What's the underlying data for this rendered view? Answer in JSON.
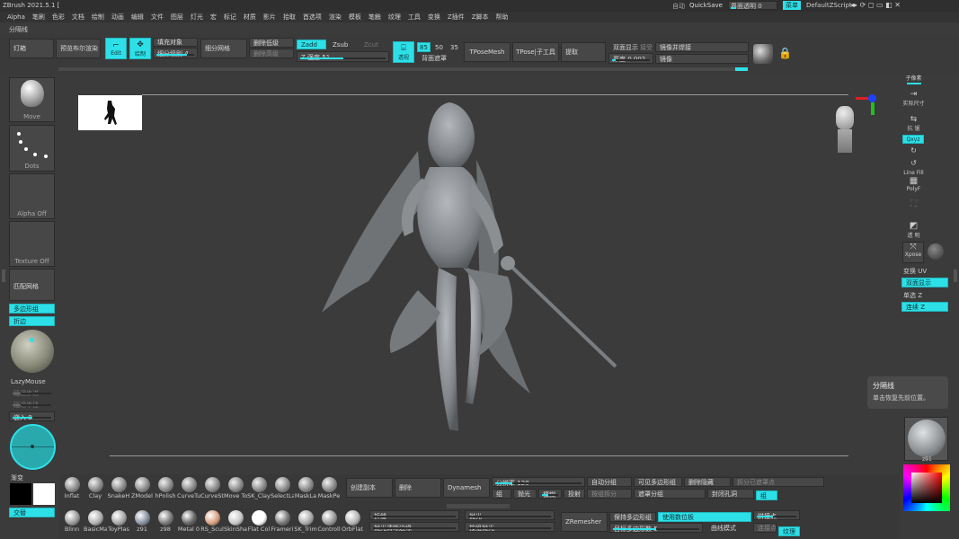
{
  "window": {
    "title": "ZBrush 2021.5.1 ["
  },
  "menu": [
    "Alpha",
    "笔刷",
    "色彩",
    "文档",
    "绘制",
    "动画",
    "编辑",
    "文件",
    "图层",
    "灯光",
    "宏",
    "标记",
    "材质",
    "影片",
    "拾取",
    "首选项",
    "渲染",
    "模板",
    "笔触",
    "纹理",
    "工具",
    "变换",
    "Z插件",
    "Z脚本",
    "帮助"
  ],
  "topright": {
    "auto": "自动",
    "quicksave": "QuickSave",
    "transparency_label": "界面透明 0",
    "menu_btn": "菜单",
    "script": "DefaultZScript"
  },
  "tray_label": "分隔线",
  "top_toolbar": {
    "light_box": "灯箱",
    "preview_boolean": "预览布尔渲染",
    "edit": "Edit",
    "draw": "绘制",
    "fill_object": "填充对象",
    "subdiv_label": "细分级别",
    "subdiv_value": "4",
    "divide_mesh": "细分网格",
    "del_lower": "删除低级",
    "del_higher": "删除高级",
    "zadd": "Zadd",
    "zsub": "Zsub",
    "zcut": "Zcut",
    "z_intensity": "Z 强度 51",
    "persp": "透视",
    "fov_85": "85",
    "fov_50": "50",
    "fov_35": "35",
    "backface": "背面遮罩",
    "tposemesh": "TPoseMesh",
    "tpose_sub": "TPose|子工具",
    "extract": "提取",
    "double_sided": "双面显示",
    "graft": "接受",
    "mirror_weld": "镜像并焊接",
    "thickness": "厚度 0.002",
    "mirror": "镜像",
    "bpr": "BPR"
  },
  "left_shelf": {
    "move": "Move",
    "dots": "Dots",
    "alpha_off": "Alpha Off",
    "texture_off": "Texture Off",
    "match_mesh": "匹配网格",
    "polygroups": "多边形组",
    "fold_edge": "折边",
    "lazymouse": "LazyMouse",
    "lazy_step": "延迟步进",
    "lazy_radius": "延迟半径",
    "embed": "嵌入 0",
    "gradient": "渐变",
    "switch": "交替"
  },
  "right_shelf": {
    "subpixel": "子像素",
    "actual": "实际尺寸",
    "aahalf": "抗 锯",
    "xyz": "Qxyz",
    "linefill": "Line Fill",
    "polyf": "PolyF",
    "transp": "透 明",
    "xpose": "Xpose",
    "uv_toggle": "变换 UV",
    "double": "双面显示",
    "solo_z": "单选 Z",
    "connect_z": "连续 Z",
    "material_name": "z91"
  },
  "tooltip": {
    "title": "分隔线",
    "body": "单击恢复先前位置。"
  },
  "bottom": {
    "brushes_row1": [
      "Inflat",
      "Clay",
      "SnakeH",
      "ZModel",
      "hPolish",
      "CurveTu",
      "CurveSt",
      "Move To",
      "SK_Clay",
      "SelectLa",
      "MaskLa",
      "MaskPe"
    ],
    "brushes_row2": [
      "Blinn",
      "BasicMa",
      "ToyPlas",
      "z91",
      "z98",
      "Metal 0",
      "RS_Scul",
      "SkinSha",
      "Flat Col",
      "Frameri",
      "SK_Trim",
      "Controll",
      "OrbFlat"
    ],
    "create_copy": "创建副本",
    "delete": "删除",
    "dynamesh": "Dynamesh",
    "resolution": "分辨率 128",
    "group": "组",
    "polish": "抛光",
    "blur": "模糊",
    "project": "投射",
    "zremesher": "ZRemesher",
    "keep_groups": "保持多边形组",
    "target_poly": "目标多边形数 5",
    "auto_group": "自动分组",
    "split_groups": "按组拆分",
    "visible_group": "可见多边形组",
    "del_hidden": "删除隐藏",
    "hole_close": "封闭孔洞",
    "split_masked": "拆分已遮罩点",
    "group_btn": "组",
    "use_polypaint": "使用数位板",
    "curve_mode": "曲线模式",
    "crease": "折缝",
    "polish2": "抛光",
    "polish_crisp": "抛光清晰边缘",
    "polish_group": "按组抛光",
    "snap_points": "拼接点",
    "connect": "连接点",
    "texture": "纹理",
    "mask_edge": "遮罩分组"
  },
  "colors": {
    "accent": "#2de0e8",
    "panel": "#474747",
    "bg": "#3b3b3b"
  }
}
